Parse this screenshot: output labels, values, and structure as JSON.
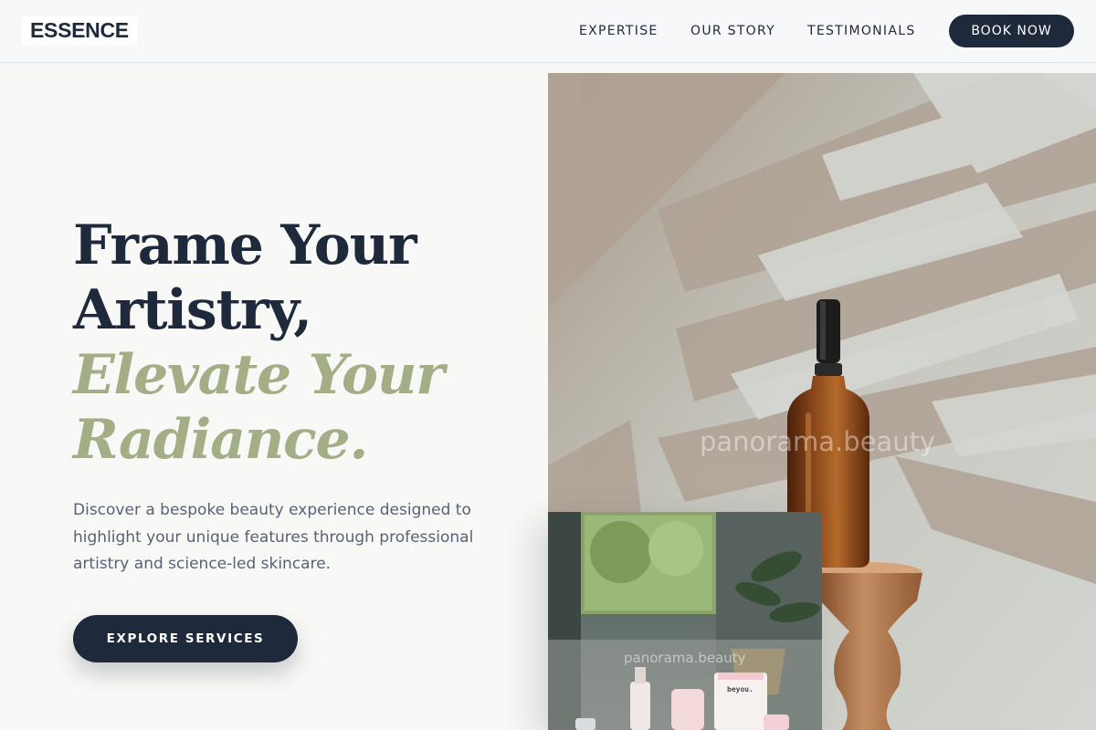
{
  "header": {
    "logo": "ESSENCE",
    "nav": [
      {
        "label": "EXPERTISE"
      },
      {
        "label": "OUR STORY"
      },
      {
        "label": "TESTIMONIALS"
      }
    ],
    "cta_label": "BOOK NOW"
  },
  "hero": {
    "headline_lines": [
      "Frame Your",
      "Artistry,"
    ],
    "accent_lines": [
      "Elevate Your",
      "Radiance."
    ],
    "description": "Discover a bespoke beauty experience designed to highlight your unique features through professional artistry and science-led skincare.",
    "cta_label": "EXPLORE SERVICES"
  },
  "images": {
    "main_watermark": "panorama.beauty",
    "inset_watermark": "panorama.beauty",
    "inset_brand_label": "beyou."
  },
  "colors": {
    "navy": "#1e293b",
    "sage_accent": "#a3ae86",
    "background": "#f8f8f6",
    "body_text": "#576274"
  }
}
